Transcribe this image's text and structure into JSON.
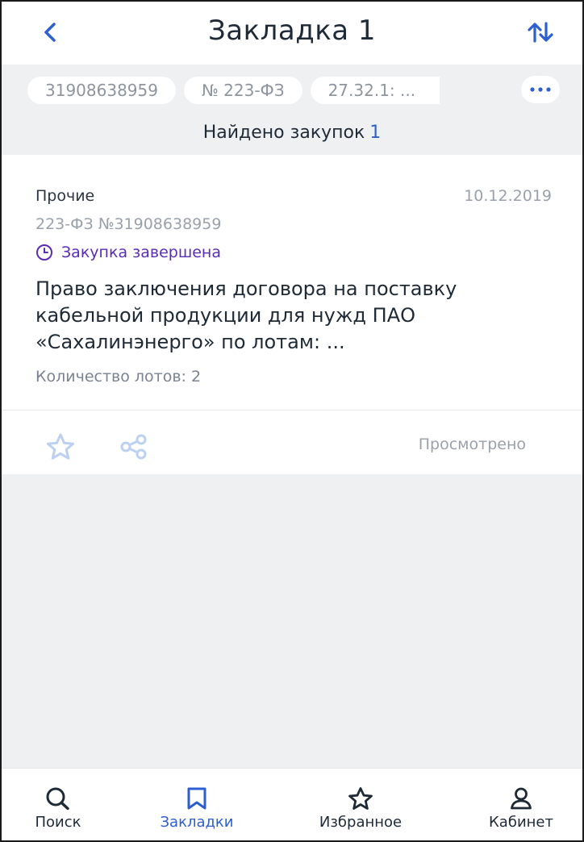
{
  "header": {
    "title": "Закладка 1",
    "back_icon": "chevron-left-icon",
    "sort_icon": "sort-arrows-icon"
  },
  "filters": {
    "chips": [
      "31908638959",
      "№ 223-ФЗ",
      "27.32.1: ..."
    ],
    "more_label": "···"
  },
  "results": {
    "label": "Найдено закупок",
    "count": "1"
  },
  "card": {
    "category": "Прочие",
    "date": "10.12.2019",
    "reg_number": "223-ФЗ №31908638959",
    "status": "Закупка завершена",
    "description": "Право заключения договора на поставку кабельной продукции для нужд ПАО «Сахалинэнерго» по лотам: ...",
    "lots": "Количество лотов: 2",
    "viewed": "Просмотрено"
  },
  "nav": {
    "items": [
      {
        "label": "Поиск",
        "icon": "search-icon"
      },
      {
        "label": "Закладки",
        "icon": "bookmark-icon"
      },
      {
        "label": "Избранное",
        "icon": "star-icon"
      },
      {
        "label": "Кабинет",
        "icon": "user-icon"
      }
    ],
    "active": "Закладки"
  },
  "colors": {
    "accent": "#2d5fd0",
    "status": "#5a2bb5",
    "muted": "#9aa1ab",
    "background": "#eff0f2"
  }
}
